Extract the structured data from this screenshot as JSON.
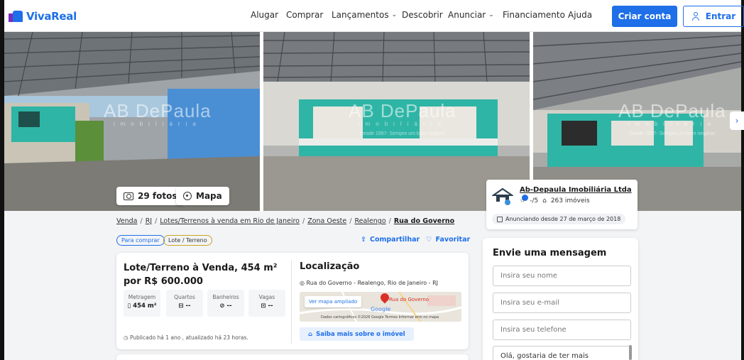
{
  "header": {
    "logo_text": "VivaReal",
    "nav": [
      {
        "label": "Alugar",
        "dropdown": false
      },
      {
        "label": "Comprar",
        "dropdown": false
      },
      {
        "label": "Lançamentos",
        "dropdown": true
      },
      {
        "label": "Descobrir",
        "dropdown": false
      },
      {
        "label": "Anunciar",
        "dropdown": true
      },
      {
        "label": "Financiamento",
        "dropdown": false
      },
      {
        "label": "Ajuda",
        "dropdown": false
      }
    ],
    "create_account": "Criar conta",
    "login": "Entrar"
  },
  "gallery": {
    "watermark_big": "AB DePaula",
    "watermark_small": "imobiliária",
    "watermark_sub": "Desde 1997- Sempre um bom negócio",
    "photos_button": "29 fotos",
    "map_button": "Mapa"
  },
  "advertiser": {
    "name": "Ab-Depaula Imobiliária Ltda",
    "rating": "-/5",
    "listings": "263 imóveis",
    "since": "Anunciando desde 27 de março de 2018"
  },
  "breadcrumb": {
    "items": [
      "Venda",
      "RJ",
      "Lotes/Terrenos à venda em Rio de Janeiro",
      "Zona Oeste",
      "Realengo"
    ],
    "current": "Rua do Governo"
  },
  "tags": {
    "buy": "Para comprar",
    "type": "Lote / Terreno"
  },
  "actions": {
    "share": "Compartilhar",
    "favorite": "Favoritar"
  },
  "listing": {
    "title": "Lote/Terreno à Venda, 454 m² por R$ 600.000",
    "features": [
      {
        "label": "Metragem",
        "value": "454 m²",
        "icon": "ruler-icon"
      },
      {
        "label": "Quartos",
        "value": "--",
        "icon": "bed-icon"
      },
      {
        "label": "Banheiros",
        "value": "--",
        "icon": "shower-icon"
      },
      {
        "label": "Vagas",
        "value": "--",
        "icon": "car-icon"
      }
    ],
    "published": "Publicado há 1 ano , atualizado há 23 horas."
  },
  "location": {
    "title": "Localização",
    "address": "Rua do Governo - Realengo, Rio de Janeiro - RJ",
    "map_button": "Ver mapa ampliado",
    "map_pin_label": "Rua do Governo",
    "map_brand": "Google",
    "map_footer": "Dados cartográficos ©2026 Google   Termos   Informar erro no mapa",
    "more_button": "Saiba mais sobre o imóvel"
  },
  "message_form": {
    "title": "Envie uma mensagem",
    "name_placeholder": "Insira seu nome",
    "email_placeholder": "Insira seu e-mail",
    "phone_placeholder": "Insira seu telefone",
    "message_value": "Olá, gostaria de ter mais"
  },
  "colors": {
    "brand": "#1e6fe8",
    "brand_purple": "#7b2cbf",
    "teal_wall": "#2fb5a6"
  }
}
